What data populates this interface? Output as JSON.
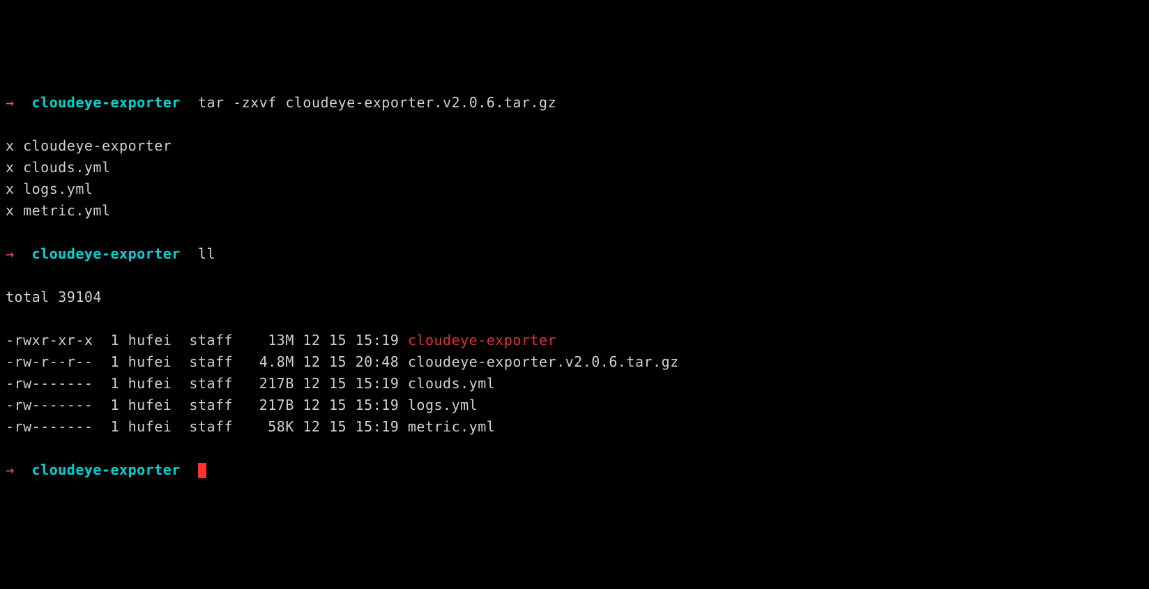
{
  "prompt": {
    "arrow": "→",
    "dir": "cloudeye-exporter"
  },
  "cmd1": "tar -zxvf cloudeye-exporter.v2.0.6.tar.gz",
  "extract": [
    "x cloudeye-exporter",
    "x clouds.yml",
    "x logs.yml",
    "x metric.yml"
  ],
  "cmd2": "ll",
  "ll_total": "total 39104",
  "ll_rows": [
    {
      "perm": "-rwxr-xr-x",
      "links": "1",
      "user": "hufei",
      "group": "staff",
      "size": " 13M",
      "date": "12 15 15:19",
      "name": "cloudeye-exporter",
      "exec": true
    },
    {
      "perm": "-rw-r--r--",
      "links": "1",
      "user": "hufei",
      "group": "staff",
      "size": "4.8M",
      "date": "12 15 20:48",
      "name": "cloudeye-exporter.v2.0.6.tar.gz",
      "exec": false
    },
    {
      "perm": "-rw-------",
      "links": "1",
      "user": "hufei",
      "group": "staff",
      "size": "217B",
      "date": "12 15 15:19",
      "name": "clouds.yml",
      "exec": false
    },
    {
      "perm": "-rw-------",
      "links": "1",
      "user": "hufei",
      "group": "staff",
      "size": "217B",
      "date": "12 15 15:19",
      "name": "logs.yml",
      "exec": false
    },
    {
      "perm": "-rw-------",
      "links": "1",
      "user": "hufei",
      "group": "staff",
      "size": " 58K",
      "date": "12 15 15:19",
      "name": "metric.yml",
      "exec": false
    }
  ]
}
